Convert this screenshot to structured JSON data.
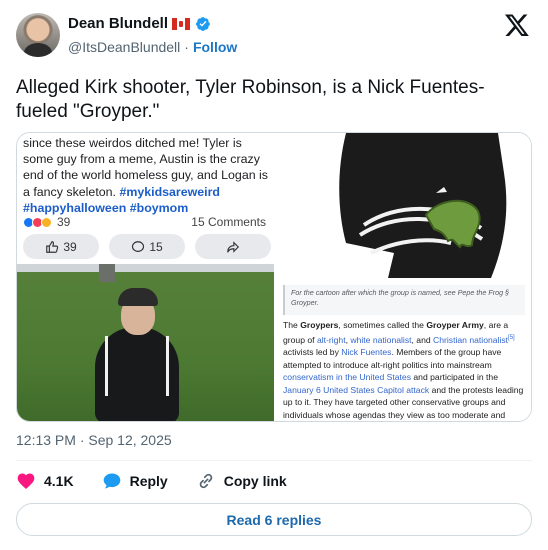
{
  "author": {
    "name": "Dean Blundell",
    "handle": "@ItsDeanBlundell",
    "separator": "·",
    "follow_label": "Follow"
  },
  "tweet": {
    "text": "Alleged Kirk shooter, Tyler Robinson, is a Nick Fuentes-fueled \"Groyper.\""
  },
  "media": {
    "facebook_post": {
      "text": "since these weirdos ditched me! Tyler is some guy from a meme, Austin is the crazy end of the world homeless guy, and Logan is a fancy skeleton.",
      "hashtags": [
        "#mykidsareweird",
        "#happyhalloween",
        "#boymom"
      ],
      "reactions_count": "39",
      "comments_label": "15 Comments",
      "like_count": "39",
      "comment_count": "15"
    },
    "wiki": {
      "hatnote": "For the cartoon after which the group is named, see Pepe the Frog § Groyper.",
      "hatnote_link": "Pepe the Frog § Groyper",
      "body_1": "The",
      "bold_1": "Groypers",
      "body_2": ", sometimes called the",
      "bold_2": "Groyper Army",
      "body_3": ", are a group of",
      "link_1": "alt-right",
      "link_2": "white nationalist",
      "body_4": ", and",
      "link_3": "Christian nationalist",
      "ref": "[5]",
      "body_5": "activists led by",
      "link_4": "Nick Fuentes",
      "body_6": ". Members of the group have attempted to introduce alt-right politics into mainstream",
      "link_5": "conservatism in the United States",
      "body_7": "and participated in the",
      "link_6": "January 6 United States Capitol attack",
      "body_8": "and the protests leading up to it. They have targeted other conservative groups and individuals whose agendas they view as too moderate and"
    }
  },
  "timestamp": "12:13 PM · Sep 12, 2025",
  "actions": {
    "likes": "4.1K",
    "reply_label": "Reply",
    "copy_link_label": "Copy link"
  },
  "read_replies_label": "Read 6 replies",
  "colors": {
    "link": "#1d77c6",
    "heart": "#f91880",
    "verified": "#1d9bf0",
    "reply_bubble": "#1d9bf0"
  }
}
